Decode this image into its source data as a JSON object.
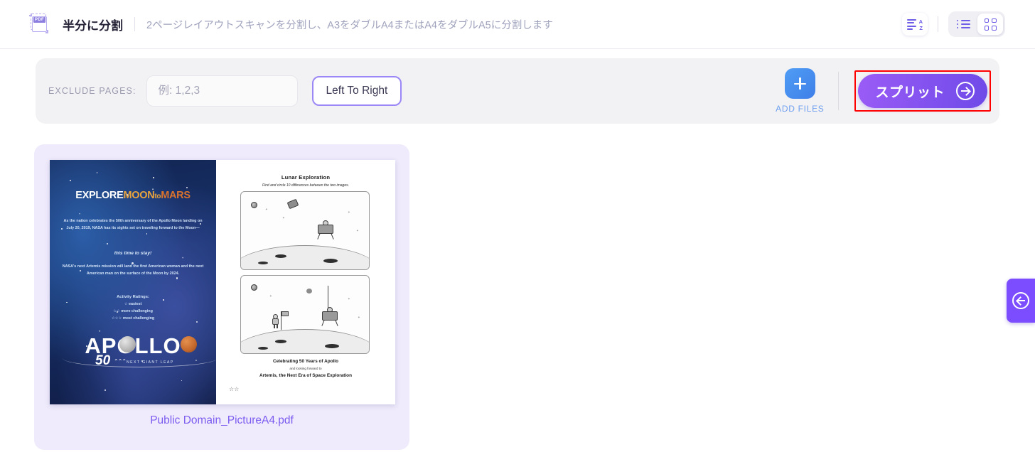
{
  "header": {
    "icon": "pdf-split-icon",
    "title": "半分に分割",
    "subtitle": "2ページレイアウトスキャンを分割し、A3をダブルA4またはA4をダブルA5に分割します",
    "sort_icon": "sort-alpha-asc-icon",
    "list_view_icon": "list-view-icon",
    "grid_view_icon": "grid-view-icon",
    "active_view": "grid"
  },
  "toolbar": {
    "exclude_label": "EXCLUDE PAGES:",
    "exclude_placeholder": "例: 1,2,3",
    "exclude_value": "",
    "direction_button": "Left To Right",
    "add_files_label": "ADD FILES",
    "add_files_icon": "plus-icon",
    "split_button": "スプリット",
    "split_arrow_icon": "arrow-right-circle-icon",
    "split_highlighted": true
  },
  "file_card": {
    "name": "Public Domain_PictureA4.pdf",
    "preview": {
      "left_page": {
        "title_parts": [
          "EXPLORE",
          "MOON",
          "to",
          "MARS"
        ],
        "body": "As the nation celebrates the 50th anniversary of the Apollo Moon landing on July 20, 2019, NASA has its sights set on traveling forward to the Moon—",
        "emphasis": "this time to stay!",
        "body2": "NASA's next Artemis mission will land the first American woman and the next American man on the surface of the Moon by 2024.",
        "ratings_header": "Activity Ratings:",
        "ratings": [
          "☆ easiest",
          "☆☆ more challenging",
          "☆☆☆ most challenging"
        ],
        "logo_word": "APOLLO",
        "logo_number": "50",
        "logo_tagline": "NEXT GIANT LEAP"
      },
      "right_page": {
        "title": "Lunar Exploration",
        "subtitle": "Find and circle 10 differences between the two images.",
        "footer1": "Celebrating 50 Years of Apollo",
        "footer2": "and looking forward to",
        "footer3": "Artemis, the Next Era of Space Exploration",
        "rating": "☆☆"
      }
    }
  },
  "edge_panel": {
    "toggle_icon": "arrow-left-circle-icon"
  },
  "colors": {
    "accent_purple": "#6c5ce7",
    "split_gradient_from": "#9b5cf6",
    "split_gradient_to": "#6e4ae8",
    "add_files_blue": "#4f9df5",
    "card_background": "#efebfc",
    "highlight_red": "#ff0000",
    "filename_purple": "#7c5cf0"
  }
}
